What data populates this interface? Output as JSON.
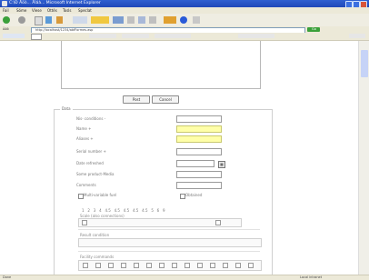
{
  "window": {
    "title": "C:\\Ð Äöò... Äîáà... Microsoft Internet Explorer"
  },
  "menu": {
    "items": [
      "Fail",
      "Sóme",
      "Víese",
      "Ottés",
      "Tosls",
      "Speclat"
    ]
  },
  "address": {
    "label": "Äðð",
    "value": "http://localhost/1234/abfFormes.asp",
    "go_label": "Go"
  },
  "form": {
    "top_buttons": [
      "Post",
      "Cancel"
    ],
    "legend": "Data",
    "fields": [
      "Nis- conditions -",
      "Name +",
      "Aliases +",
      "Serial number +",
      "Date refreshed",
      "Some product-Media",
      "Comments"
    ],
    "checkboxes": [
      "Multi-variable fuel",
      "Obtained"
    ],
    "scale_numbers": "1   2   3   4   4.5   4.5   4.5   4.5   4.5   5   6   9",
    "scale_label": "Scale (also connections)",
    "section2_label": "Result condition",
    "section3_label": "Facility commands"
  },
  "status": {
    "left": "Done",
    "right": "Local intranet"
  },
  "colors": {
    "title_bar": "#2f5fd0",
    "required_field": "#ffffa8",
    "chrome": "#ece9d8"
  }
}
